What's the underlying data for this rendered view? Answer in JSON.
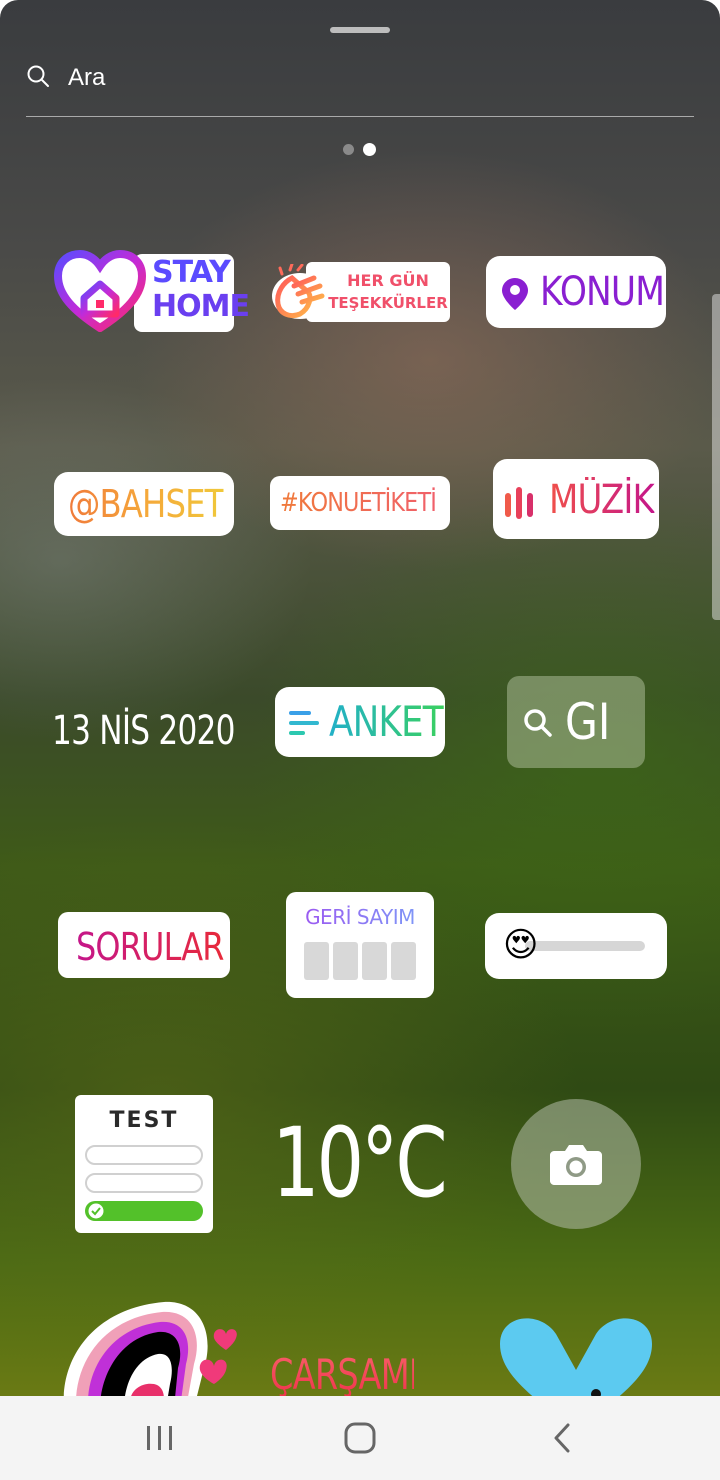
{
  "search": {
    "placeholder": "Ara"
  },
  "stickers": {
    "stay_home": {
      "line1": "STAY",
      "line2": "HOME"
    },
    "thanks": {
      "line1": "HER GÜN",
      "line2": "TEŞEKKÜRLER"
    },
    "location": "KONUM",
    "mention": "@BAHSET",
    "hashtag": "#KONUETİKETİ",
    "music": "MÜZİK",
    "date": "13 NİS 2020",
    "poll": "ANKET",
    "gif": "GI",
    "questions": "SORULAR",
    "countdown": "GERİ SAYIM",
    "slider_emoji": "😍",
    "quiz": "TEST",
    "temperature": "10°C",
    "day": "ÇARŞAMBA"
  },
  "colors": {
    "konum": "#8a1fd1",
    "muzik": "#d12a6a",
    "anket": "#27c28a",
    "sorular": "#c4168a",
    "quiz_green": "#53c12a"
  },
  "nav": {
    "recents": "recents-icon",
    "home": "home-icon",
    "back": "back-icon"
  }
}
